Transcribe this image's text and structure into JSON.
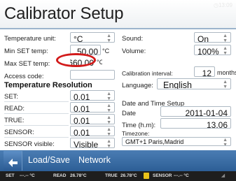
{
  "header": {
    "title": "Calibrator Setup",
    "clock": "13:09"
  },
  "left": {
    "temperature_unit": {
      "label": "Temperature unit:",
      "value": "°C"
    },
    "min_set_temp": {
      "label": "Min SET temp:",
      "value": "50.00",
      "unit": "°C"
    },
    "max_set_temp": {
      "label": "Max SET temp:",
      "value": "660.00",
      "unit": "°C"
    },
    "access_code": {
      "label": "Access code:",
      "value": ""
    },
    "resolution_heading": "Temperature Resolution",
    "set": {
      "label": "SET:",
      "value": "0.01"
    },
    "read": {
      "label": "READ:",
      "value": "0.01"
    },
    "true": {
      "label": "TRUE:",
      "value": "0.01"
    },
    "sensor": {
      "label": "SENSOR:",
      "value": "0.01"
    },
    "sensor_visible": {
      "label": "SENSOR visible:",
      "value": "Visible"
    }
  },
  "right": {
    "sound": {
      "label": "Sound:",
      "value": "On"
    },
    "volume": {
      "label": "Volume:",
      "value": "100%"
    },
    "calibration_interval": {
      "label": "Calibration interval:",
      "value": "12",
      "unit": "months"
    },
    "language": {
      "label": "Language:",
      "value": "English"
    },
    "datetime_heading": "Date and Time Setup",
    "date": {
      "label": "Date",
      "value": "2011-01-04"
    },
    "time": {
      "label": "Time (h.m):",
      "value": "13.06"
    },
    "timezone": {
      "label": "Timezone:",
      "value": "GMT+1 Paris,Madrid"
    }
  },
  "bottom": {
    "back_icon": "back-arrow-icon",
    "load_save": "Load/Save",
    "network": "Network"
  },
  "statusbar": {
    "set_label": "SET",
    "set_value": "---.-- °C",
    "read_label": "READ",
    "read_value": "26.78°C",
    "true_label": "TRUE",
    "true_value": "26.78°C",
    "sensor_label": "SENSOR",
    "sensor_value": "---.-- °C"
  },
  "colors": {
    "accent": "#2d5e96",
    "annotation": "#d21a1a",
    "status_bg": "#1e1e1e"
  }
}
